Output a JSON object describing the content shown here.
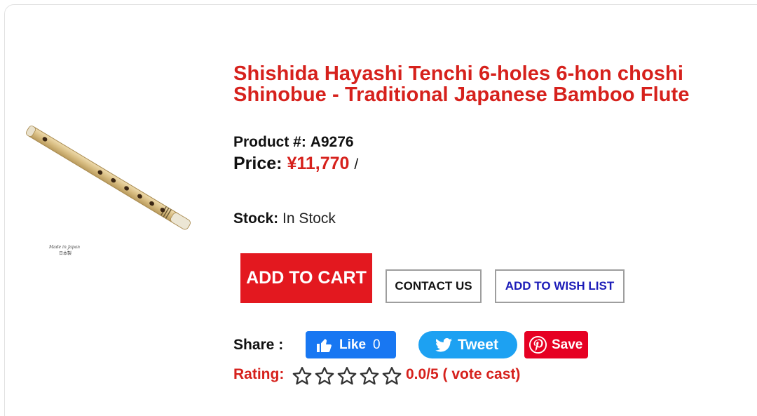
{
  "product": {
    "title_line1": "Shishida Hayashi Tenchi 6-holes 6-hon choshi",
    "title_line2": "Shinobue - Traditional Japanese Bamboo Flute",
    "product_label": "Product #:",
    "product_number": "A9276",
    "price_label": "Price:",
    "price_value": "¥11,770",
    "price_separator": "/",
    "stock_label": "Stock:",
    "stock_value": "In Stock",
    "image_caption_line1": "Made in Japan",
    "image_caption_line2": "日本製"
  },
  "actions": {
    "add_to_cart": "ADD TO CART",
    "contact_us": "CONTACT US",
    "add_to_wish_list": "ADD TO WISH LIST"
  },
  "share": {
    "label": "Share :",
    "facebook_label": "Like",
    "facebook_count": "0",
    "twitter_label": "Tweet",
    "pinterest_label": "Save"
  },
  "rating": {
    "label": "Rating:",
    "stars_total": 5,
    "stars_filled": 0,
    "value_text": "0.0/5 ( vote cast)"
  },
  "colors": {
    "accent_red": "#d6211c",
    "cart_button": "#e3181f",
    "wish_link": "#1b1bb8",
    "facebook": "#1877f2",
    "twitter": "#1da1f2",
    "pinterest": "#e60023"
  },
  "icons": [
    "thumbs-up-icon",
    "twitter-bird-icon",
    "pinterest-icon",
    "star-outline-icon"
  ]
}
